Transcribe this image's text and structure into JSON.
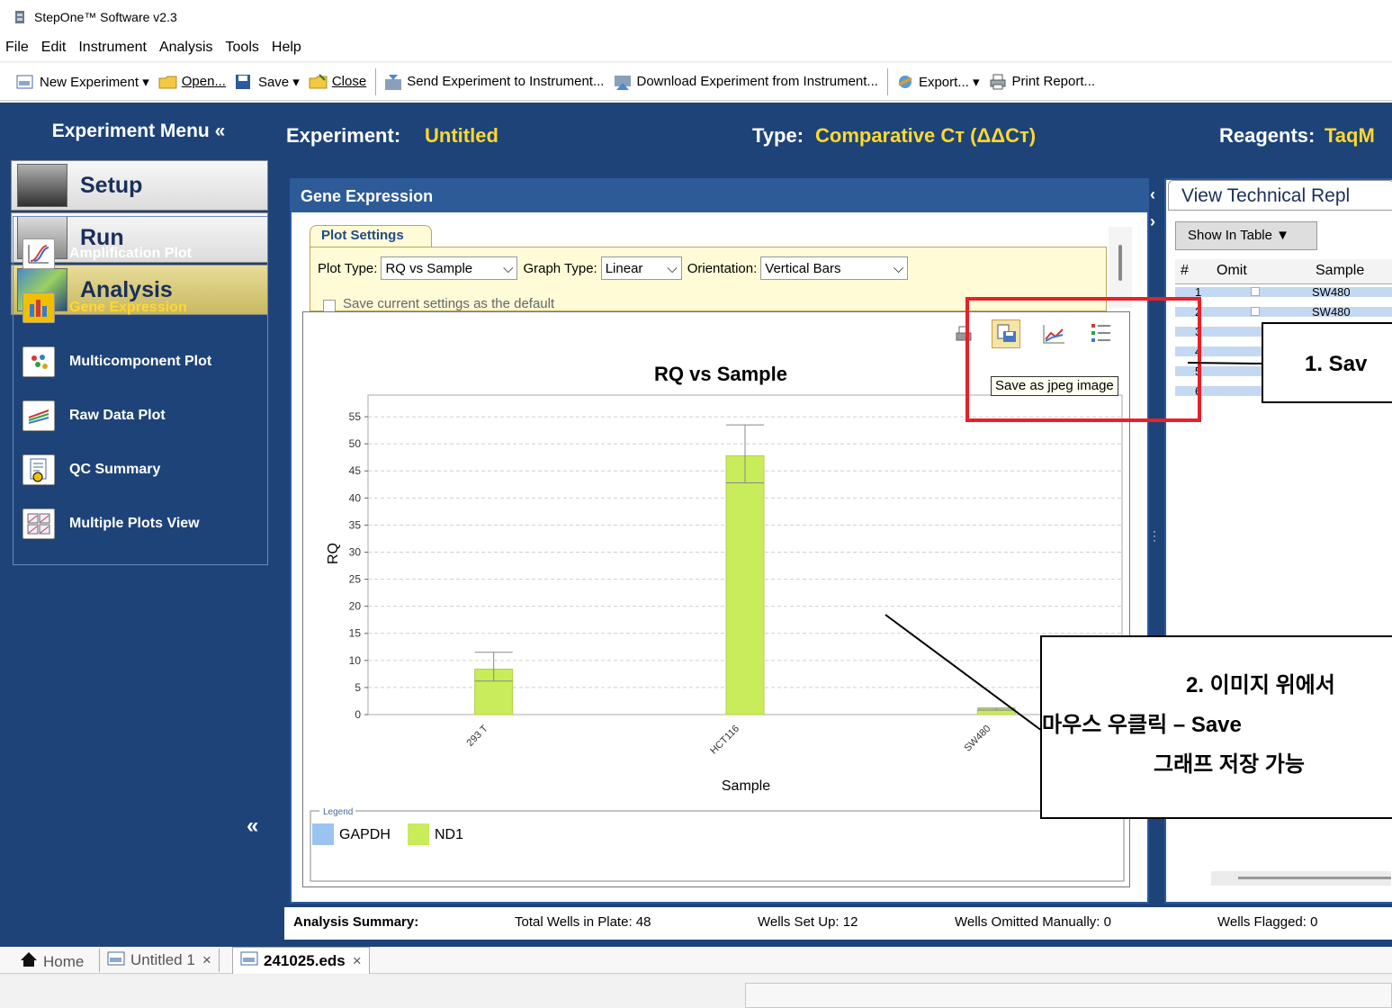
{
  "window": {
    "title": "StepOne™ Software v2.3"
  },
  "menu": [
    "File",
    "Edit",
    "Instrument",
    "Analysis",
    "Tools",
    "Help"
  ],
  "toolbar": {
    "new_experiment": "New Experiment ▾",
    "open": "Open...",
    "save": "Save ▾",
    "close": "Close",
    "send": "Send Experiment to Instrument...",
    "download": "Download Experiment from Instrument...",
    "export": "Export... ▾",
    "print": "Print Report..."
  },
  "sidebar": {
    "title": "Experiment Menu «",
    "main": [
      "Setup",
      "Run",
      "Analysis"
    ],
    "analysis_items": [
      "Amplification Plot",
      "Gene Expression",
      "Multicomponent Plot",
      "Raw Data Plot",
      "QC Summary",
      "Multiple Plots View"
    ],
    "collapse": "«"
  },
  "header": {
    "experiment_label": "Experiment:",
    "experiment_value": "Untitled",
    "type_label": "Type:",
    "type_value": "Comparative Cт (ΔΔCт)",
    "reagents_label": "Reagents:",
    "reagents_value": "TaqM"
  },
  "gene_panel": {
    "title": "Gene Expression",
    "plot_settings_tab": "Plot Settings",
    "plot_type_label": "Plot Type:",
    "plot_type_value": "RQ vs Sample",
    "graph_type_label": "Graph Type:",
    "graph_type_value": "Linear",
    "orientation_label": "Orientation:",
    "orientation_value": "Vertical Bars",
    "save_default": "Save current settings as the default",
    "tooltip": "Save as jpeg image"
  },
  "chart_data": {
    "type": "bar",
    "title": "RQ vs Sample",
    "xlabel": "Sample",
    "ylabel": "RQ",
    "ylim": [
      0,
      59
    ],
    "yticks": [
      0,
      5,
      10,
      15,
      20,
      25,
      30,
      35,
      40,
      45,
      50,
      55
    ],
    "categories": [
      "293 T",
      "HCT116",
      "SW480"
    ],
    "series": [
      {
        "name": "GAPDH",
        "color": "#99c4f0",
        "values": [
          0,
          0,
          0
        ]
      },
      {
        "name": "ND1",
        "color": "#c8ec5a",
        "values": [
          8.4,
          47.8,
          1.0
        ],
        "error_low": [
          6.2,
          42.8,
          0.8
        ],
        "error_high": [
          11.5,
          53.5,
          1.2
        ]
      }
    ],
    "legend_title": "Legend",
    "legend_position": "bottom",
    "grid": true
  },
  "right_panel": {
    "tab": "View Technical Repl",
    "show_in_table": "Show In Table ▼",
    "columns": [
      "#",
      "Omit",
      "Sample"
    ],
    "rows": [
      {
        "num": "1",
        "sample": "SW480"
      },
      {
        "num": "2",
        "sample": "SW480"
      },
      {
        "num": "3",
        "sample": ""
      },
      {
        "num": "4",
        "sample": ""
      },
      {
        "num": "5",
        "sample": ""
      },
      {
        "num": "6",
        "sample": ""
      }
    ]
  },
  "summary": {
    "label": "Analysis Summary:",
    "total": "Total Wells in Plate: 48",
    "setup": "Wells Set Up: 12",
    "omitted": "Wells Omitted Manually: 0",
    "flagged": "Wells Flagged: 0"
  },
  "tabs": {
    "home": "Home",
    "untitled": "Untitled 1",
    "file": "241025.eds",
    "close": "×"
  },
  "callouts": {
    "one": "1. Sav",
    "two_line1": "2. 이미지 위에서",
    "two_line2": "마우스 우클릭 – Save",
    "two_line3": "그래프 저장 가능"
  }
}
